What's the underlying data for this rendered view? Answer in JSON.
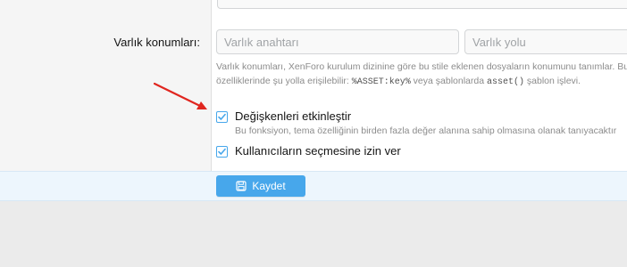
{
  "form": {
    "asset_locations": {
      "label": "Varlık konumları:",
      "key_placeholder": "Varlık anahtarı",
      "path_placeholder": "Varlık yolu",
      "explain_line1": "Varlık konumları, XenForo kurulum dizinine göre bu stile eklenen dosyaların konumunu tanımlar. Bu",
      "explain_line2_pre": "özelliklerinde şu yolla erişilebilir: ",
      "explain_code1": "%ASSET:key%",
      "explain_line2_mid": " veya şablonlarda ",
      "explain_code2": "asset()",
      "explain_line2_post": " şablon işlevi."
    },
    "enable_variations": {
      "label": "Değişkenleri etkinleştir",
      "hint": "Bu fonksiyon, tema özelliğinin birden fazla değer alanına sahip olmasına olanak tanıyacaktır",
      "checked": true
    },
    "user_selectable": {
      "label": "Kullanıcıların seçmesine izin ver",
      "checked": true
    }
  },
  "footer": {
    "save_label": "Kaydet",
    "save_icon": "save-icon"
  },
  "colors": {
    "accent": "#47a7eb",
    "annotation_arrow": "#e0261f"
  }
}
